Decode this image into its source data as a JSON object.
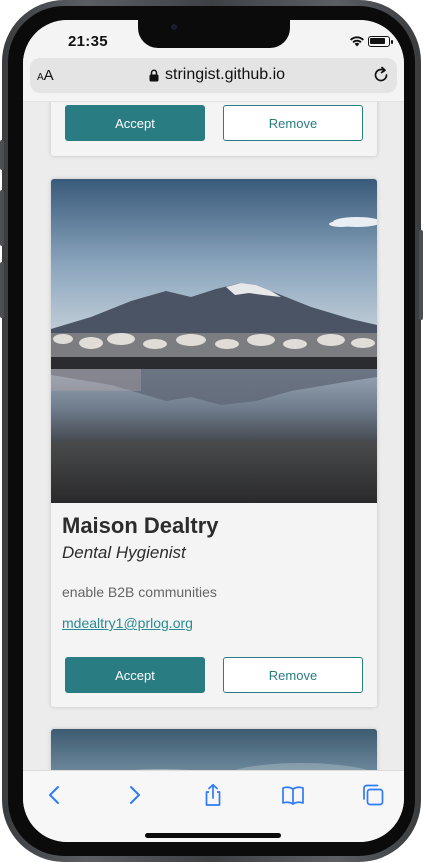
{
  "status_bar": {
    "time": "21:35"
  },
  "browser": {
    "text_size_label_small": "A",
    "text_size_label_large": "A",
    "url": "stringist.github.io"
  },
  "cards": [
    {
      "accept_label": "Accept",
      "remove_label": "Remove"
    },
    {
      "name": "Maison Dealtry",
      "title": "Dental Hygienist",
      "description": "enable B2B communities",
      "email": "mdealtry1@prlog.org",
      "accept_label": "Accept",
      "remove_label": "Remove"
    }
  ],
  "toolbar_icons": [
    "back-icon",
    "forward-icon",
    "share-icon",
    "bookmarks-icon",
    "tabs-icon"
  ],
  "colors": {
    "accent": "#2a7c83",
    "link": "#2a8a93",
    "ios_blue": "#2f7bf6"
  }
}
